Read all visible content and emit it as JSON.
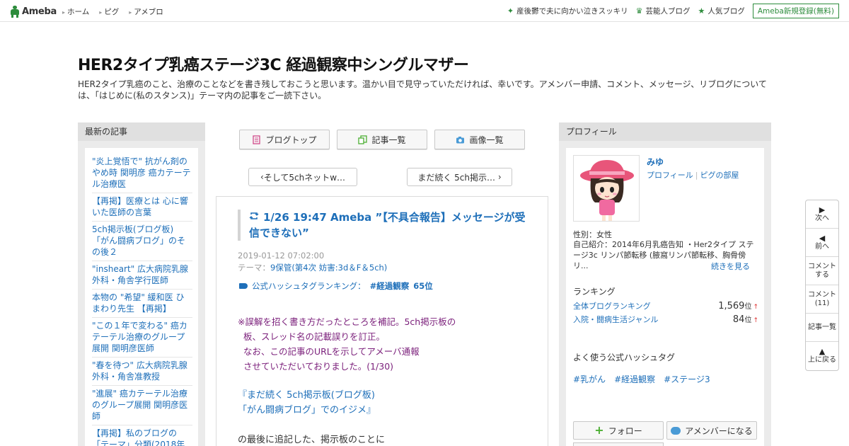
{
  "topbar": {
    "logo_text": "Ameba",
    "nav": [
      "ホーム",
      "ピグ",
      "アメブロ"
    ],
    "right_links": [
      {
        "label": "産後鬱で夫に向かい泣きスッキリ",
        "icon": "sparkle-icon"
      },
      {
        "label": "芸能人ブログ",
        "icon": "crown-icon"
      },
      {
        "label": "人気ブログ",
        "icon": "star-icon"
      }
    ],
    "register_label": "Ameba新規登録(無料)"
  },
  "header": {
    "title": "HER2タイプ乳癌ステージ3C 経過観察中シングルマザー",
    "description": "HER2タイプ乳癌のこと、治療のことなどを書き残しておこうと思います。温かい目で見守っていただければ、幸いです。アメンバー申請、コメント、メッセージ、リブログについては、「はじめに(私のスタンス)」テーマ内の記事をご一読下さい。"
  },
  "left": {
    "heading": "最新の記事",
    "items": [
      "\"炎上覚悟で\" 抗がん剤のやめ時 関明彦 癌カテーテル治療医",
      "【再掲】医療とは 心に響いた医師の言葉",
      "5ch掲示板(ブログ板) 「がん闘病ブログ」のその後２",
      "\"insheart\" 広大病院乳腺外科・角舎学行医師",
      "本物の \"希望\" 緩和医 ひまわり先生 【再掲】",
      "\"この１年で変わる\" 癌カテーテル治療のグループ展開 関明彦医師",
      "\"春を待つ\" 広大病院乳腺外科・角舎准教授",
      "\"進展\" 癌カテーテル治療のグループ展開 関明彦医師",
      "【再掲】私のブログの「テーマ」分類(2018年"
    ]
  },
  "center": {
    "tabs": [
      {
        "label": "ブログトップ",
        "icon": "document-icon"
      },
      {
        "label": "記事一覧",
        "icon": "copy-icon"
      },
      {
        "label": "画像一覧",
        "icon": "camera-icon"
      }
    ],
    "prev_label": "そして5chネットw…",
    "next_label": "まだ続く 5ch掲示…",
    "article": {
      "title": "1/26 19:47 Ameba ”【不具合報告】メッセージが受信できない”",
      "date": "2019-01-12 07:02:00",
      "theme_prefix": "テーマ：",
      "theme": "9保管(第4次 妨害:3d＆F＆5ch)",
      "hashtag_label": "公式ハッシュタグランキング：",
      "hashtag": "#経過観察",
      "hashtag_rank": "65位",
      "body_notice": "※誤解を招く書き方だったところを補記。5ch掲示板の\n  板、スレッド名の記載誤りを訂正。\n  なお、この記事のURLを示してアメーバ通報\n  させていただいておりました。(1/30)",
      "body_link": "『まだ続く 5ch掲示板(ブログ板)\n「がん闘病ブログ」でのイジメ』",
      "body_text": "の最後に追記した、掲示板のことに"
    }
  },
  "right": {
    "heading": "プロフィール",
    "name": "みゆ",
    "link_profile": "プロフィール",
    "link_pigg": "ピグの部屋",
    "gender": "性別：女性",
    "intro": "自己紹介：2014年6月乳癌告知 ・Her2タイプ ステージ3c リンパ節転移 (腋窩リンパ節転移、胸骨傍リ...",
    "read_more": "続きを見る",
    "ranking_heading": "ランキング",
    "rankings": [
      {
        "label": "全体ブログランキング",
        "value": "1,569",
        "unit": "位",
        "arrow": "↑"
      },
      {
        "label": "入院・闘病生活ジャンル",
        "value": "84",
        "unit": "位",
        "arrow": "↑"
      }
    ],
    "hashtag_heading": "よく使う公式ハッシュタグ",
    "hashtags": [
      "#乳がん",
      "#経過観察",
      "#ステージ3"
    ],
    "follow_label": "フォロー",
    "member_label": "アメンバーになる"
  },
  "sidenav": [
    {
      "label": "次へ",
      "icon": "play-right-icon"
    },
    {
      "label": "前へ",
      "icon": "play-left-icon"
    },
    {
      "label": "コメント\nする",
      "icon": ""
    },
    {
      "label": "コメント\n(11)",
      "icon": ""
    },
    {
      "label": "記事一覧",
      "icon": ""
    },
    {
      "label": "上に戻る",
      "icon": "up-arrow-icon"
    }
  ],
  "colors": {
    "brand_green": "#2d8c3c",
    "link_blue": "#1e6fb9",
    "notice_purple": "#7a1e7a"
  }
}
